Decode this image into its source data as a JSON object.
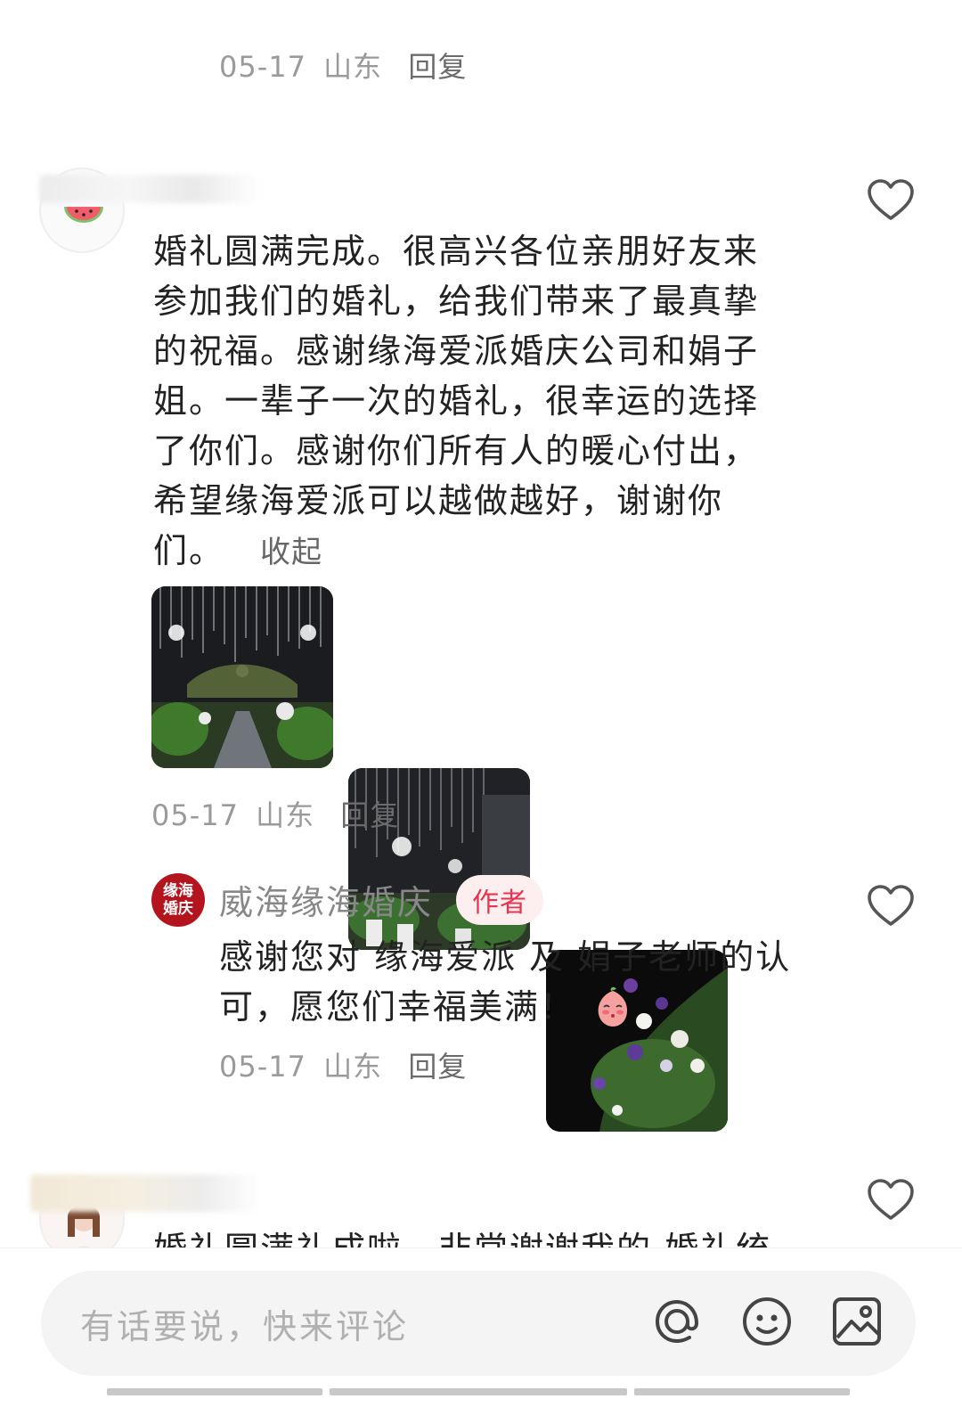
{
  "prev_reply": {
    "date": "05-17",
    "location": "山东",
    "reply": "回复"
  },
  "comment": {
    "text_lines": [
      "婚礼圆满完成。很高兴各位亲朋好友来",
      "参加我们的婚礼，给我们带来了最真挚",
      "的祝福。感谢缘海爱派婚庆公司和娟子",
      "姐。一辈子一次的婚礼，很幸运的选择",
      "了你们。感谢你们所有人的暖心付出，",
      "希望缘海爱派可以越做越好，谢谢你",
      "们。"
    ],
    "collapse": "收起",
    "date": "05-17",
    "location": "山东",
    "reply": "回复",
    "avatar_icon": "watermelon-icon"
  },
  "author_reply": {
    "logo_text_1": "缘海",
    "logo_text_2": "婚庆",
    "name": "威海缘海婚庆",
    "badge": "作者",
    "text_line_1": "感谢您对 缘海爱派 及 娟子老师的认",
    "text_line_2": "可，愿您们幸福美满！",
    "emoji": "blushing-peach-emoji",
    "date": "05-17",
    "location": "山东",
    "reply": "回复"
  },
  "next_comment": {
    "partial_text": "婚礼圆满礼成啦，非常谢谢我的 婚礼统"
  },
  "input": {
    "placeholder": "有话要说，快来评论",
    "icons": [
      "at-icon",
      "emoji-icon",
      "image-icon"
    ]
  },
  "colors": {
    "badge_text": "#e8344e",
    "badge_bg": "#fdeef0",
    "brand": "#b3141d"
  }
}
